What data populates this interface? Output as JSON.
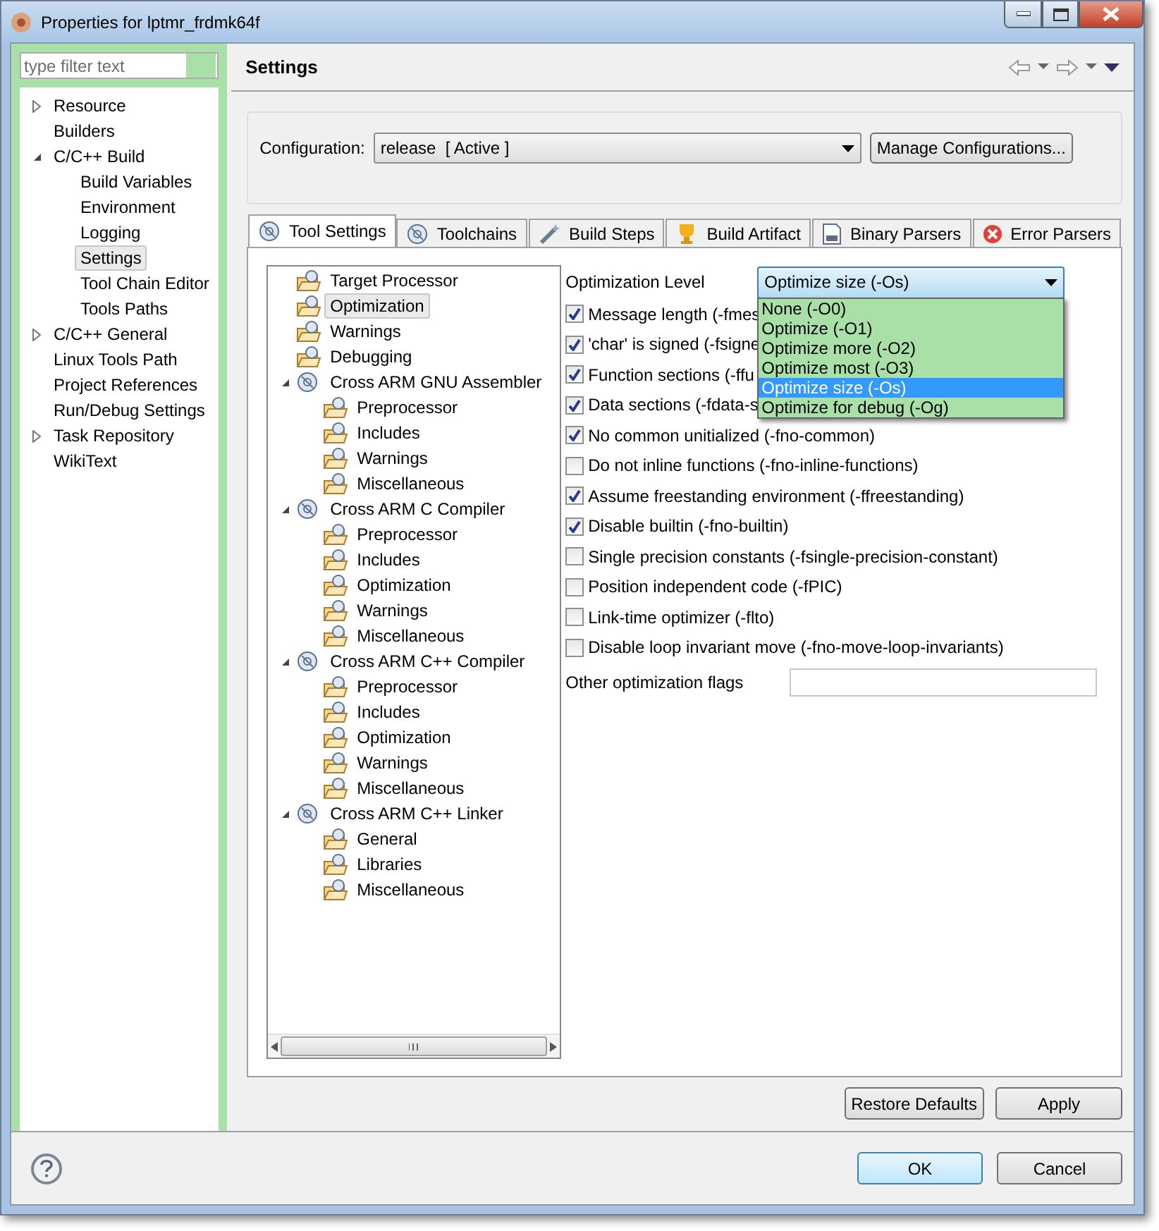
{
  "window": {
    "title": "Properties for lptmr_frdmk64f"
  },
  "filter": {
    "placeholder": "type filter text"
  },
  "sidebar": {
    "items": [
      {
        "label": "Resource",
        "expanded": false,
        "selected": false
      },
      {
        "label": "Builders",
        "selected": false
      },
      {
        "label": "C/C++ Build",
        "expanded": true,
        "selected": false,
        "children": [
          {
            "label": "Build Variables",
            "selected": false
          },
          {
            "label": "Environment",
            "selected": false
          },
          {
            "label": "Logging",
            "selected": false
          },
          {
            "label": "Settings",
            "selected": true
          },
          {
            "label": "Tool Chain Editor",
            "selected": false
          },
          {
            "label": "Tools Paths",
            "selected": false
          }
        ]
      },
      {
        "label": "C/C++ General",
        "expanded": false,
        "selected": false
      },
      {
        "label": "Linux Tools Path",
        "selected": false
      },
      {
        "label": "Project References",
        "selected": false
      },
      {
        "label": "Run/Debug Settings",
        "selected": false
      },
      {
        "label": "Task Repository",
        "expanded": false,
        "selected": false
      },
      {
        "label": "WikiText",
        "selected": false
      }
    ]
  },
  "page": {
    "title": "Settings"
  },
  "configuration": {
    "label": "Configuration:",
    "value": "release  [ Active ]",
    "button": "Manage Configurations..."
  },
  "tabs": [
    {
      "label": "Tool Settings",
      "selected": true
    },
    {
      "label": "Toolchains",
      "selected": false
    },
    {
      "label": "Build Steps",
      "selected": false
    },
    {
      "label": "Build Artifact",
      "selected": false
    },
    {
      "label": "Binary Parsers",
      "selected": false
    },
    {
      "label": "Error Parsers",
      "selected": false
    }
  ],
  "tool_tree": [
    {
      "label": "Target Processor",
      "selected": false
    },
    {
      "label": "Optimization",
      "selected": true
    },
    {
      "label": "Warnings",
      "selected": false
    },
    {
      "label": "Debugging",
      "selected": false
    },
    {
      "label": "Cross ARM GNU Assembler",
      "expanded": true,
      "selected": false,
      "children": [
        {
          "label": "Preprocessor",
          "selected": false
        },
        {
          "label": "Includes",
          "selected": false
        },
        {
          "label": "Warnings",
          "selected": false
        },
        {
          "label": "Miscellaneous",
          "selected": false
        }
      ]
    },
    {
      "label": "Cross ARM C Compiler",
      "expanded": true,
      "selected": false,
      "children": [
        {
          "label": "Preprocessor",
          "selected": false
        },
        {
          "label": "Includes",
          "selected": false
        },
        {
          "label": "Optimization",
          "selected": false
        },
        {
          "label": "Warnings",
          "selected": false
        },
        {
          "label": "Miscellaneous",
          "selected": false
        }
      ]
    },
    {
      "label": "Cross ARM C++ Compiler",
      "expanded": true,
      "selected": false,
      "children": [
        {
          "label": "Preprocessor",
          "selected": false
        },
        {
          "label": "Includes",
          "selected": false
        },
        {
          "label": "Optimization",
          "selected": false
        },
        {
          "label": "Warnings",
          "selected": false
        },
        {
          "label": "Miscellaneous",
          "selected": false
        }
      ]
    },
    {
      "label": "Cross ARM C++ Linker",
      "expanded": true,
      "selected": false,
      "children": [
        {
          "label": "General",
          "selected": false
        },
        {
          "label": "Libraries",
          "selected": false
        },
        {
          "label": "Miscellaneous",
          "selected": false
        }
      ]
    }
  ],
  "optimization_level": {
    "label": "Optimization Level",
    "value": "Optimize size (-Os)",
    "open": true,
    "options": [
      {
        "label": "None (-O0)",
        "selected": false
      },
      {
        "label": "Optimize (-O1)",
        "selected": false
      },
      {
        "label": "Optimize more (-O2)",
        "selected": false
      },
      {
        "label": "Optimize most (-O3)",
        "selected": false
      },
      {
        "label": "Optimize size (-Os)",
        "selected": true
      },
      {
        "label": "Optimize for debug (-Og)",
        "selected": false
      }
    ]
  },
  "options": [
    {
      "label": "Message length (-fmes",
      "checked": true
    },
    {
      "label": "'char' is signed (-fsigne",
      "checked": true
    },
    {
      "label": "Function sections (-ffu",
      "checked": true
    },
    {
      "label": "Data sections (-fdata-s",
      "checked": true
    },
    {
      "label": "No common unitialized (-fno-common)",
      "checked": true
    },
    {
      "label": "Do not inline functions (-fno-inline-functions)",
      "checked": false
    },
    {
      "label": "Assume freestanding environment (-ffreestanding)",
      "checked": true
    },
    {
      "label": "Disable builtin (-fno-builtin)",
      "checked": true
    },
    {
      "label": "Single precision constants (-fsingle-precision-constant)",
      "checked": false
    },
    {
      "label": "Position independent code (-fPIC)",
      "checked": false
    },
    {
      "label": "Link-time optimizer (-flto)",
      "checked": false
    },
    {
      "label": "Disable loop invariant move (-fno-move-loop-invariants)",
      "checked": false
    }
  ],
  "other_flags": {
    "label": "Other optimization flags"
  },
  "page_buttons": [
    "Restore Defaults",
    "Apply"
  ],
  "dialog_buttons": [
    {
      "label": "OK",
      "default": true
    },
    {
      "label": "Cancel",
      "default": false
    }
  ]
}
